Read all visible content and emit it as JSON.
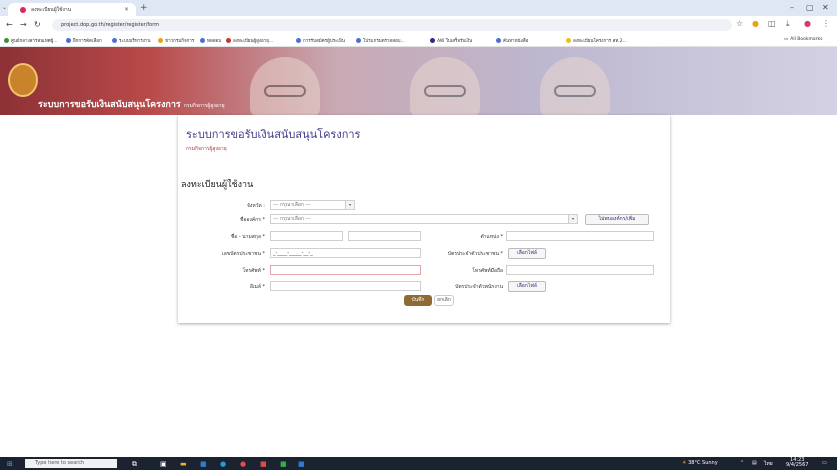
{
  "browser": {
    "tab_title": "ลงทะเบียนผู้ใช้งาน",
    "url": "project.dop.go.th/register/register/form",
    "bookmarks": [
      "ศูนย์กลางสารสนเทศผู้...",
      "ฝึกการคัดเลือก",
      "ระบบบริหารงาน",
      "ข่าวกรมกิจการ",
      "ทดสอบ",
      "ลงทะเบียนผู้สูงอายุ...",
      "การรับสมัครผู้ประเมิน",
      "โปรแกรมตรวจสอบ...",
      "AW ใบเสร็จรับเงิน",
      "ค้นหาหนังสือ",
      "ลงทะเบียนโครงการ สท.2..."
    ],
    "all_bookmarks": "All Bookmarks"
  },
  "banner": {
    "title": "ระบบการขอรับเงินสนับสนุนโครงการ",
    "subtitle": "กรมกิจการผู้สูงอายุ"
  },
  "page": {
    "title": "ระบบการขอรับเงินสนับสนุนโครงการ",
    "subtitle": "กรมกิจการผู้สูงอายุ",
    "section_title": "ลงทะเบียนผู้ใช้งาน"
  },
  "form": {
    "province_label": "จังหวัด :",
    "province_value": "--- กรุณาเลือก ---",
    "org_label": "ชื่อองค์กร *",
    "org_value": "--- กรุณาเลือก ---",
    "new_org_button": "ไม่พบองค์กร/เพิ่ม",
    "name_label": "ชื่อ - นามสกุล *",
    "position_label": "ตำแหน่ง *",
    "id_card_label": "เลขบัตรประชาชน *",
    "id_card_value": "_-____-_____-__-_",
    "id_copy_label": "บัตรประจำตัวประชาชน *",
    "file_button_1": "เลือกไฟล์",
    "phone_label": "โทรศัพท์ *",
    "mobile_label": "โทรศัพท์มือถือ",
    "email_label": "อีเมล์ *",
    "staff_card_label": "บัตรประจำตัวพนักงาน",
    "file_button_2": "เลือกไฟล์",
    "save_button": "บันทึก",
    "cancel_button": "ยกเลิก"
  },
  "taskbar": {
    "search_placeholder": "Type here to search",
    "weather": "38°C Sunny",
    "time": "14:23",
    "date": "9/4/2567"
  }
}
